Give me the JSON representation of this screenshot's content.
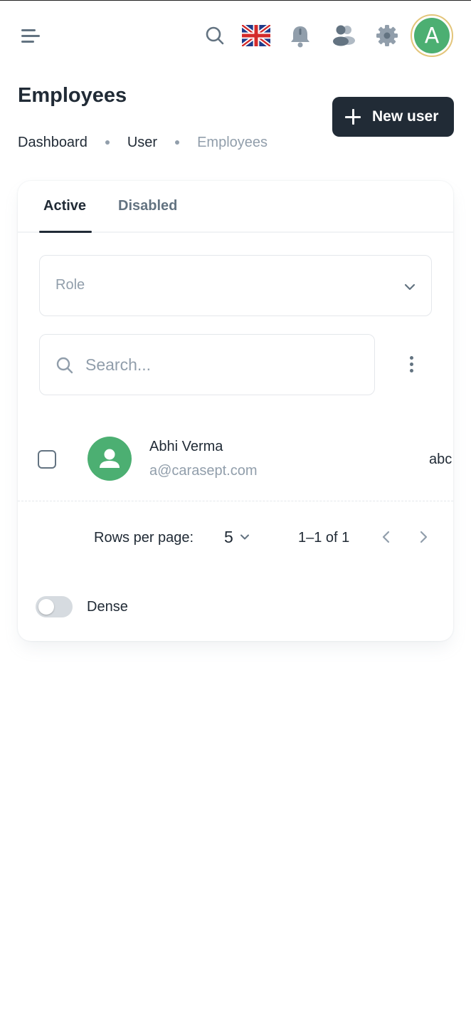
{
  "header": {
    "avatar_initial": "A",
    "icons": [
      "menu-icon",
      "search-icon",
      "uk-flag-icon",
      "bell-icon",
      "contacts-icon",
      "gear-icon"
    ]
  },
  "page": {
    "title": "Employees",
    "new_user_label": "New user",
    "breadcrumb": [
      "Dashboard",
      "User",
      "Employees"
    ]
  },
  "tabs": [
    {
      "label": "Active",
      "selected": true
    },
    {
      "label": "Disabled",
      "selected": false
    }
  ],
  "filters": {
    "role_placeholder": "Role",
    "search_placeholder": "Search..."
  },
  "rows": [
    {
      "name": "Abhi Verma",
      "email": "a@carasept.com",
      "extra": "abc"
    }
  ],
  "pagination": {
    "rows_per_page_label": "Rows per page:",
    "rows_per_page": "5",
    "range": "1–1 of 1"
  },
  "dense": {
    "label": "Dense",
    "enabled": false
  },
  "colors": {
    "primary_dark": "#212b36",
    "avatar_green": "#4caf72",
    "muted": "#919eab",
    "secondary": "#637381"
  }
}
